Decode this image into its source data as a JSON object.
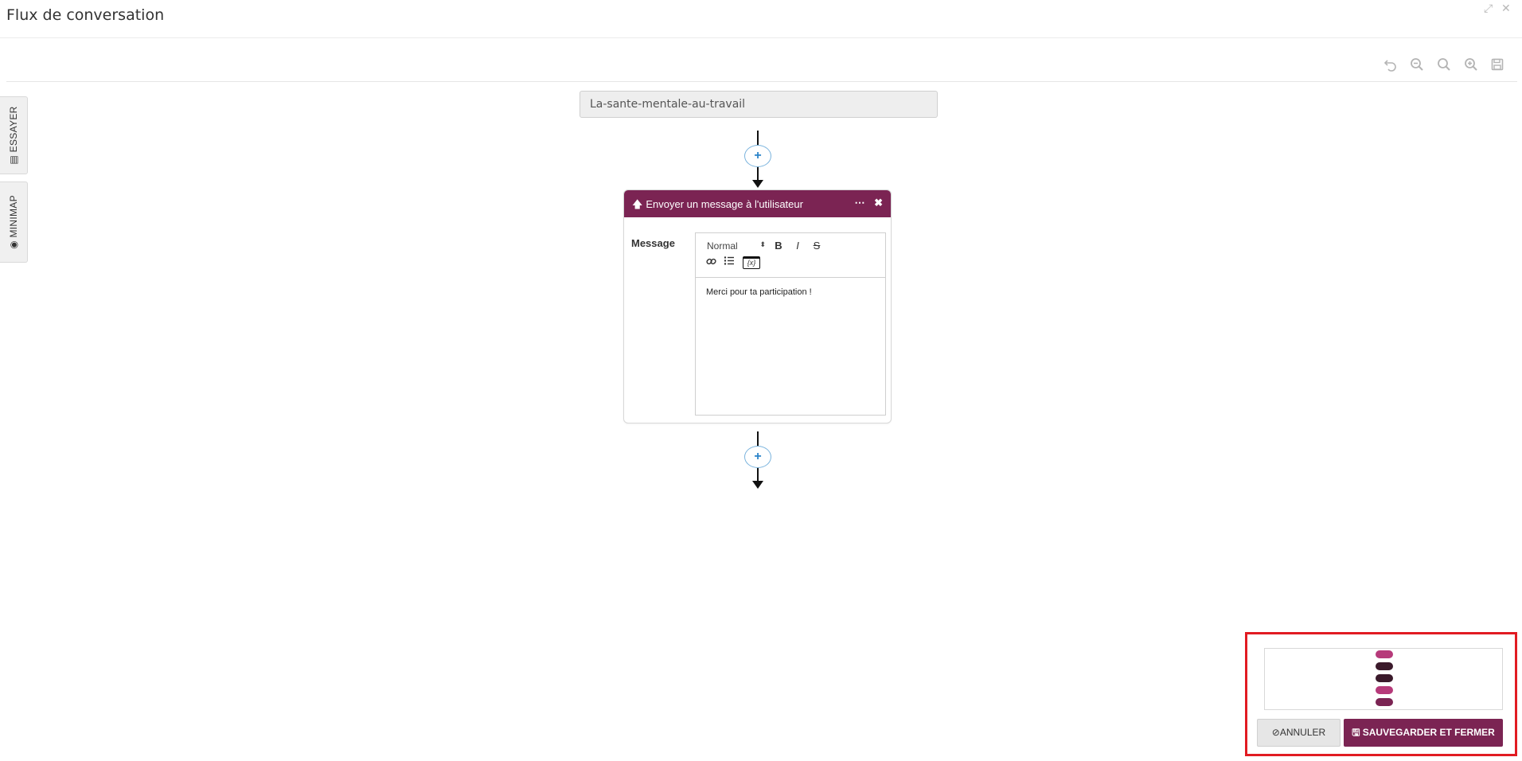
{
  "window": {
    "title": "Flux de conversation",
    "expand_icon": "expand-icon",
    "close_icon": "close-icon"
  },
  "toolbar": {
    "icons": [
      "undo-icon",
      "zoom-out-icon",
      "search-icon",
      "zoom-in-icon",
      "save-icon"
    ]
  },
  "side_tabs": {
    "essayer": "ESSAYER",
    "minimap": "MINIMAP"
  },
  "flow": {
    "start_node_label": "La-sante-mentale-au-travail",
    "add_step_symbol": "+",
    "node": {
      "header_title": "Envoyer un message à l'utilisateur",
      "header_icon": "arrow-up-icon",
      "more_symbol": "⋯",
      "close_symbol": "✖",
      "field_label": "Message",
      "editor": {
        "format_value": "Normal",
        "buttons": [
          "bold",
          "italic",
          "strike",
          "link",
          "list",
          "variable"
        ],
        "bold_symbol": "B",
        "italic_symbol": "I",
        "strike_symbol": "S",
        "variable_symbol": "{x}",
        "content": "Merci pour ta participation !"
      }
    }
  },
  "bottom_panel": {
    "preview_pills": [
      "#b63a7a",
      "#3b1a2b",
      "#3b1a2b",
      "#b63a7a",
      "#7b2453"
    ],
    "cancel_label": "ANNULER",
    "save_label": "SAUVEGARDER ET FERMER"
  },
  "colors": {
    "brand": "#7b2453",
    "highlight_border": "#e11b22",
    "link_blue": "#2a83c9"
  }
}
